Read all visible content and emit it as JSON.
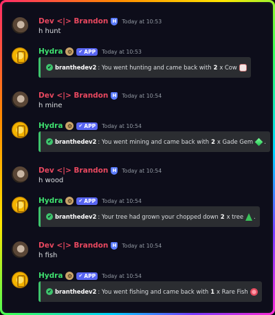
{
  "messages": [
    {
      "kind": "user",
      "name": "Dev <|> Brandon",
      "time": "Today at 10:53",
      "text": "h hunt"
    },
    {
      "kind": "bot",
      "name": "Hydra",
      "app_label": "APP",
      "time": "Today at 10:53",
      "embed": {
        "user": "branthedev2",
        "text_before": ": You went hunting and came back with",
        "count": "2",
        "text_after": "x Cow",
        "emoji": "cow-icon"
      }
    },
    {
      "kind": "user",
      "name": "Dev <|> Brandon",
      "time": "Today at 10:54",
      "text": "h mine"
    },
    {
      "kind": "bot",
      "name": "Hydra",
      "app_label": "APP",
      "time": "Today at 10:54",
      "embed": {
        "user": "branthedev2",
        "text_before": ": You went mining and came back with",
        "count": "2",
        "text_after": "x Gade Gem",
        "emoji": "gem-icon",
        "tail": "."
      }
    },
    {
      "kind": "user",
      "name": "Dev <|> Brandon",
      "time": "Today at 10:54",
      "text": "h wood"
    },
    {
      "kind": "bot",
      "name": "Hydra",
      "app_label": "APP",
      "time": "Today at 10:54",
      "embed": {
        "user": "branthedev2",
        "text_before": ": Your tree had grown your chopped down",
        "count": "2",
        "text_after": "x tree",
        "emoji": "tree-icon",
        "tail": "."
      }
    },
    {
      "kind": "user",
      "name": "Dev <|> Brandon",
      "time": "Today at 10:54",
      "text": "h fish"
    },
    {
      "kind": "bot",
      "name": "Hydra",
      "app_label": "APP",
      "time": "Today at 10:54",
      "embed": {
        "user": "branthedev2",
        "text_before": ": You went fishing and came back with",
        "count": "1",
        "text_after": "x Rare Fish",
        "emoji": "fish-icon"
      }
    }
  ]
}
